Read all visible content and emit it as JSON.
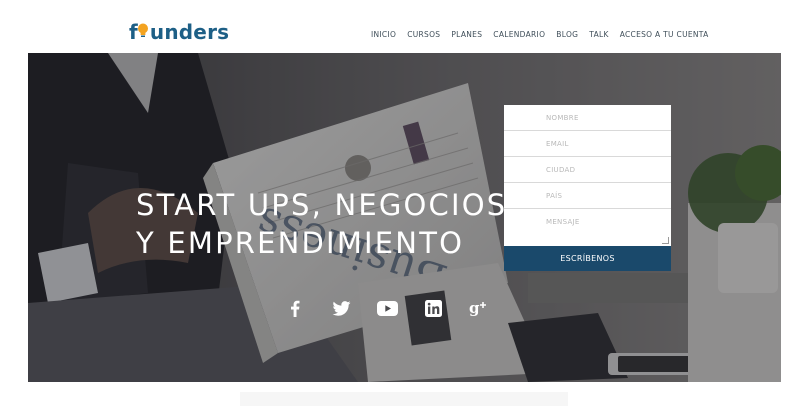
{
  "brand": {
    "logo_text_prefix": "f",
    "logo_text_suffix": "unders",
    "logo_color": "#1d5f86",
    "bulb_color": "#f3a321"
  },
  "nav": {
    "items": [
      "INICIO",
      "CURSOS",
      "PLANES",
      "CALENDARIO",
      "BLOG",
      "TALK",
      "ACCESO A TU CUENTA"
    ]
  },
  "hero": {
    "headline_line1": "START UPS, NEGOCIOS",
    "headline_line2": "Y EMPRENDIMIENTO"
  },
  "social": {
    "icons": [
      "facebook-icon",
      "twitter-icon",
      "youtube-icon",
      "linkedin-icon",
      "google-plus-icon"
    ]
  },
  "form": {
    "name_placeholder": "NOMBRE",
    "email_placeholder": "EMAIL",
    "city_placeholder": "CIUDAD",
    "country_placeholder": "PAÍS",
    "message_placeholder": "MENSAJE",
    "submit_label": "ESCRÍBENOS",
    "submit_color": "#1a496b"
  }
}
